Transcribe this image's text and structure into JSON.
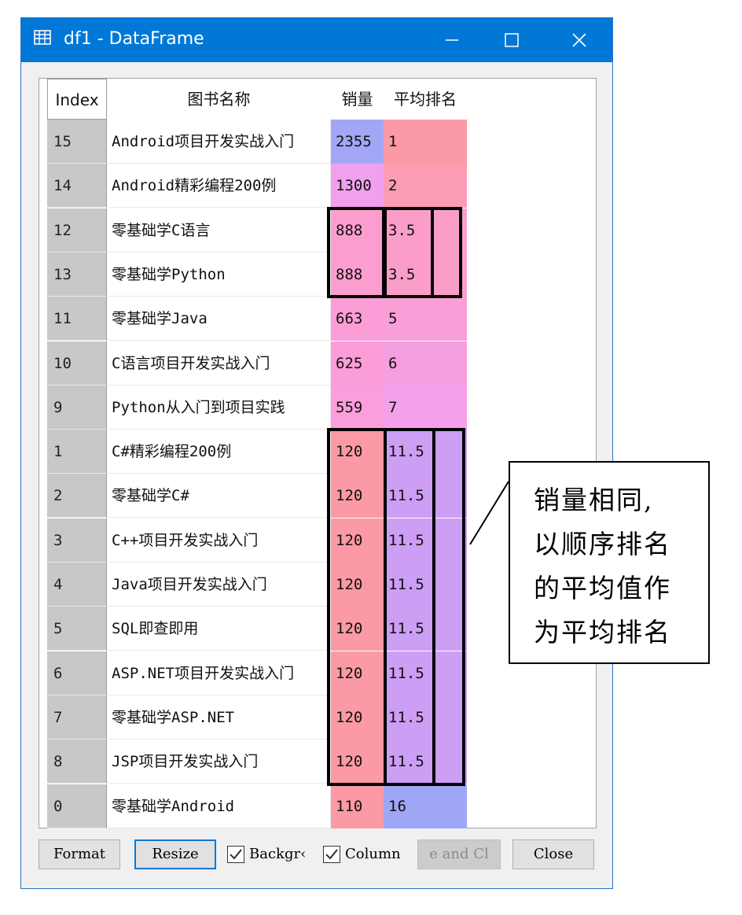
{
  "window": {
    "title": "df1 - DataFrame",
    "min_symbol": "—",
    "max_symbol": "☐",
    "close_symbol": "✕"
  },
  "table": {
    "headers": {
      "index": "Index",
      "name": "图书名称",
      "sales": "销量",
      "rank": "平均排名"
    },
    "rows": [
      {
        "index": "15",
        "name": "Android项目开发实战入门",
        "sales": "2355",
        "rank": "1",
        "sales_color": "#a3a6f4",
        "rank_color": "#fb9aa6"
      },
      {
        "index": "14",
        "name": "Android精彩编程200例",
        "sales": "1300",
        "rank": "2",
        "sales_color": "#f1a0ee",
        "rank_color": "#fb9cb4"
      },
      {
        "index": "12",
        "name": "零基础学C语言",
        "sales": "888",
        "rank": "3.5",
        "sales_color": "#fb9ecf",
        "rank_color": "#fa9ec9"
      },
      {
        "index": "13",
        "name": "零基础学Python",
        "sales": "888",
        "rank": "3.5",
        "sales_color": "#fb9ecf",
        "rank_color": "#fa9ec9"
      },
      {
        "index": "11",
        "name": "零基础学Java",
        "sales": "663",
        "rank": "5",
        "sales_color": "#fb9dd6",
        "rank_color": "#f89fd8"
      },
      {
        "index": "10",
        "name": "C语言项目开发实战入门",
        "sales": "625",
        "rank": "6",
        "sales_color": "#fb9dd8",
        "rank_color": "#f59fe0"
      },
      {
        "index": "9",
        "name": "Python从入门到项目实践",
        "sales": "559",
        "rank": "7",
        "sales_color": "#fa9edc",
        "rank_color": "#f3a1ea"
      },
      {
        "index": "1",
        "name": "C#精彩编程200例",
        "sales": "120",
        "rank": "11.5",
        "sales_color": "#fb9aa4",
        "rank_color": "#cc9ef4"
      },
      {
        "index": "2",
        "name": "零基础学C#",
        "sales": "120",
        "rank": "11.5",
        "sales_color": "#fb9aa4",
        "rank_color": "#cc9ef4"
      },
      {
        "index": "3",
        "name": "C++项目开发实战入门",
        "sales": "120",
        "rank": "11.5",
        "sales_color": "#fb9aa4",
        "rank_color": "#cc9ef4"
      },
      {
        "index": "4",
        "name": "Java项目开发实战入门",
        "sales": "120",
        "rank": "11.5",
        "sales_color": "#fb9aa4",
        "rank_color": "#cc9ef4"
      },
      {
        "index": "5",
        "name": "SQL即查即用",
        "sales": "120",
        "rank": "11.5",
        "sales_color": "#fb9aa4",
        "rank_color": "#cc9ef4"
      },
      {
        "index": "6",
        "name": "ASP.NET项目开发实战入门",
        "sales": "120",
        "rank": "11.5",
        "sales_color": "#fb9aa4",
        "rank_color": "#cc9ef4"
      },
      {
        "index": "7",
        "name": "零基础学ASP.NET",
        "sales": "120",
        "rank": "11.5",
        "sales_color": "#fb9aa4",
        "rank_color": "#cc9ef4"
      },
      {
        "index": "8",
        "name": "JSP项目开发实战入门",
        "sales": "120",
        "rank": "11.5",
        "sales_color": "#fb9aa4",
        "rank_color": "#cc9ef4"
      },
      {
        "index": "0",
        "name": "零基础学Android",
        "sales": "110",
        "rank": "16",
        "sales_color": "#fb9aa4",
        "rank_color": "#a0a6f6"
      }
    ]
  },
  "buttons": {
    "format": "Format",
    "resize": "Resize",
    "background_label": "Backgr‹",
    "column_label": "Column",
    "save_close": "e and Cl",
    "close": "Close"
  },
  "checkboxes": {
    "background_checked": true,
    "column_checked": true
  },
  "annotation": {
    "lines": [
      "销量相同,",
      "以顺序排名",
      "的平均值作",
      "为平均排名"
    ]
  }
}
